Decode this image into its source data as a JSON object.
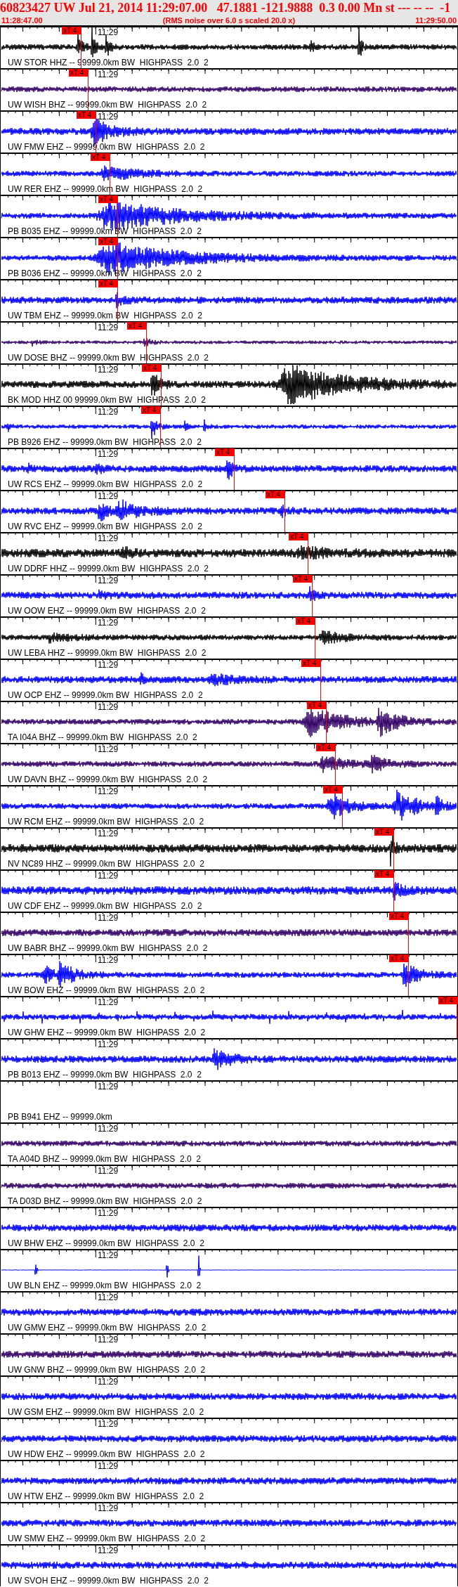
{
  "header": {
    "title": "60823427 UW Jul 21, 2014 11:29:07.00   47.1881 -121.9888  0.3 0.00 Mn st --- -- --  -1",
    "start_time": "11:28:47.00",
    "note": "(RMS noise over 6.0 s scaled 20.0 x)",
    "end_time": "11:29:50.00"
  },
  "traces": [
    {
      "label": "UW STOR HHZ -- 99999.0km BW  HIGHPASS  2.0  2",
      "time_label": "11:29",
      "color": "#000000",
      "pick": "xT 4"
    },
    {
      "label": "UW WISH BHZ -- 99999.0km BW  HIGHPASS  2.0  2",
      "time_label": "11:29",
      "color": "#330066",
      "pick": "xT 4"
    },
    {
      "label": "UW FMW EHZ -- 99999.0km BW  HIGHPASS  2.0  2",
      "time_label": "11:29",
      "color": "#0000ff",
      "pick": "xT 4"
    },
    {
      "label": "UW RER EHZ -- 99999.0km BW  HIGHPASS  2.0  2",
      "color": "#0000ff",
      "pick": "xT 4"
    },
    {
      "label": "PB B035 EHZ -- 99999.0km BW  HIGHPASS  2.0  2",
      "color": "#0000ff",
      "pick": "xT 4"
    },
    {
      "label": "PB B036 EHZ -- 99999.0km BW  HIGHPASS  2.0  2",
      "color": "#0000ff",
      "pick": "xT 4"
    },
    {
      "label": "UW TBM EHZ -- 99999.0km BW  HIGHPASS  2.0  2",
      "color": "#0000ff",
      "pick": "xT 4"
    },
    {
      "label": "UW DOSE BHZ -- 99999.0km BW  HIGHPASS  2.0  2",
      "time_label": "11:29",
      "color": "#330066",
      "pick": "xT 4"
    },
    {
      "label": "BK MOD HHZ 00 99999.0km BW  HIGHPASS  2.0  2",
      "time_label": "11:29",
      "color": "#000000",
      "pick": "xT 4"
    },
    {
      "label": "PB B926 EHZ -- 99999.0km BW  HIGHPASS  2.0  2",
      "time_label": "11:29",
      "color": "#0000ff",
      "pick": "xT 4"
    },
    {
      "label": "UW RCS EHZ -- 99999.0km BW  HIGHPASS  2.0  2",
      "time_label": "11:29",
      "color": "#0000ff",
      "pick": "xT 4"
    },
    {
      "label": "UW RVC EHZ -- 99999.0km BW  HIGHPASS  2.0  2",
      "time_label": "11:29",
      "color": "#0000ff",
      "pick": "xT 4"
    },
    {
      "label": "UW DDRF HHZ -- 99999.0km BW  HIGHPASS  2.0  2",
      "time_label": "11:29",
      "color": "#000000",
      "pick": "xT 4"
    },
    {
      "label": "UW OOW EHZ -- 99999.0km BW  HIGHPASS  2.0  2",
      "time_label": "11:29",
      "color": "#0000ff",
      "pick": "xT 4"
    },
    {
      "label": "UW LEBA HHZ -- 99999.0km BW  HIGHPASS  2.0  2",
      "time_label": "11:29",
      "color": "#000000",
      "pick": "xT 4"
    },
    {
      "label": "UW OCP EHZ -- 99999.0km BW  HIGHPASS  2.0  2",
      "time_label": "11:29",
      "color": "#0000ff",
      "pick": "xT 4"
    },
    {
      "label": "TA I04A BHZ -- 99999.0km BW  HIGHPASS  2.0  2",
      "time_label": "11:29",
      "color": "#330066",
      "pick": "xT 4"
    },
    {
      "label": "UW DAVN BHZ -- 99999.0km BW  HIGHPASS  2.0  2",
      "time_label": "11:29",
      "color": "#330066",
      "pick": "xT 4"
    },
    {
      "label": "UW RCM EHZ -- 99999.0km BW  HIGHPASS  2.0  2",
      "time_label": "11:29",
      "color": "#0000ff",
      "pick": "xT 4"
    },
    {
      "label": "NV NC89 HHZ -- 99999.0km BW  HIGHPASS  2.0  2",
      "time_label": "11:29",
      "color": "#000000",
      "pick": "xT 4"
    },
    {
      "label": "UW CDF EHZ -- 99999.0km BW  HIGHPASS  2.0  2",
      "time_label": "11:29",
      "color": "#0000ff",
      "pick": "xT 4"
    },
    {
      "label": "UW BABR BHZ -- 99999.0km BW  HIGHPASS  2.0  2",
      "time_label": "11:29",
      "color": "#330066",
      "pick": "xT 4"
    },
    {
      "label": "UW BOW EHZ -- 99999.0km BW  HIGHPASS  2.0  2",
      "time_label": "11:29",
      "color": "#0000ff",
      "pick": "xT 4"
    },
    {
      "label": "UW GHW EHZ -- 99999.0km BW  HIGHPASS  2.0  2",
      "time_label": "11:29",
      "color": "#0000ff",
      "pick": "xT 4"
    },
    {
      "label": "PB B013 EHZ -- 99999.0km BW  HIGHPASS  2.0  2",
      "time_label": "11:29",
      "color": "#0000ff"
    },
    {
      "label": "PB B941 EHZ -- 99999.0km",
      "time_label": "11:29"
    },
    {
      "label": "TA A04D BHZ -- 99999.0km BW  HIGHPASS  2.0  2",
      "time_label": "11:29",
      "color": "#330066"
    },
    {
      "label": "TA D03D BHZ -- 99999.0km BW  HIGHPASS  2.0  2",
      "time_label": "11:29",
      "color": "#330066"
    },
    {
      "label": "UW BHW EHZ -- 99999.0km BW  HIGHPASS  2.0  2",
      "time_label": "11:29",
      "color": "#0000ff"
    },
    {
      "label": "UW BLN EHZ -- 99999.0km BW  HIGHPASS  2.0  2",
      "time_label": "11:29",
      "color": "#0000ff"
    },
    {
      "label": "UW GMW EHZ -- 99999.0km BW  HIGHPASS  2.0  2",
      "time_label": "11:29",
      "color": "#0000ff"
    },
    {
      "label": "UW GNW BHZ -- 99999.0km BW  HIGHPASS  2.0  2",
      "time_label": "11:29",
      "color": "#330066"
    },
    {
      "label": "UW GSM EHZ -- 99999.0km BW  HIGHPASS  2.0  2",
      "time_label": "11:29",
      "color": "#0000ff"
    },
    {
      "label": "UW HDW EHZ -- 99999.0km BW  HIGHPASS  2.0  2",
      "time_label": "11:29",
      "color": "#0000ff"
    },
    {
      "label": "UW HTW EHZ -- 99999.0km BW  HIGHPASS  2.0  2",
      "time_label": "11:29",
      "color": "#0000ff"
    },
    {
      "label": "UW SMW EHZ -- 99999.0km BW  HIGHPASS  2.0  2",
      "time_label": "11:29",
      "color": "#0000ff"
    },
    {
      "label": "UW SVOH EHZ -- 99999.0km BW  HIGHPASS  2.0  2",
      "time_label": "11:29",
      "color": "#0000ff"
    }
  ]
}
